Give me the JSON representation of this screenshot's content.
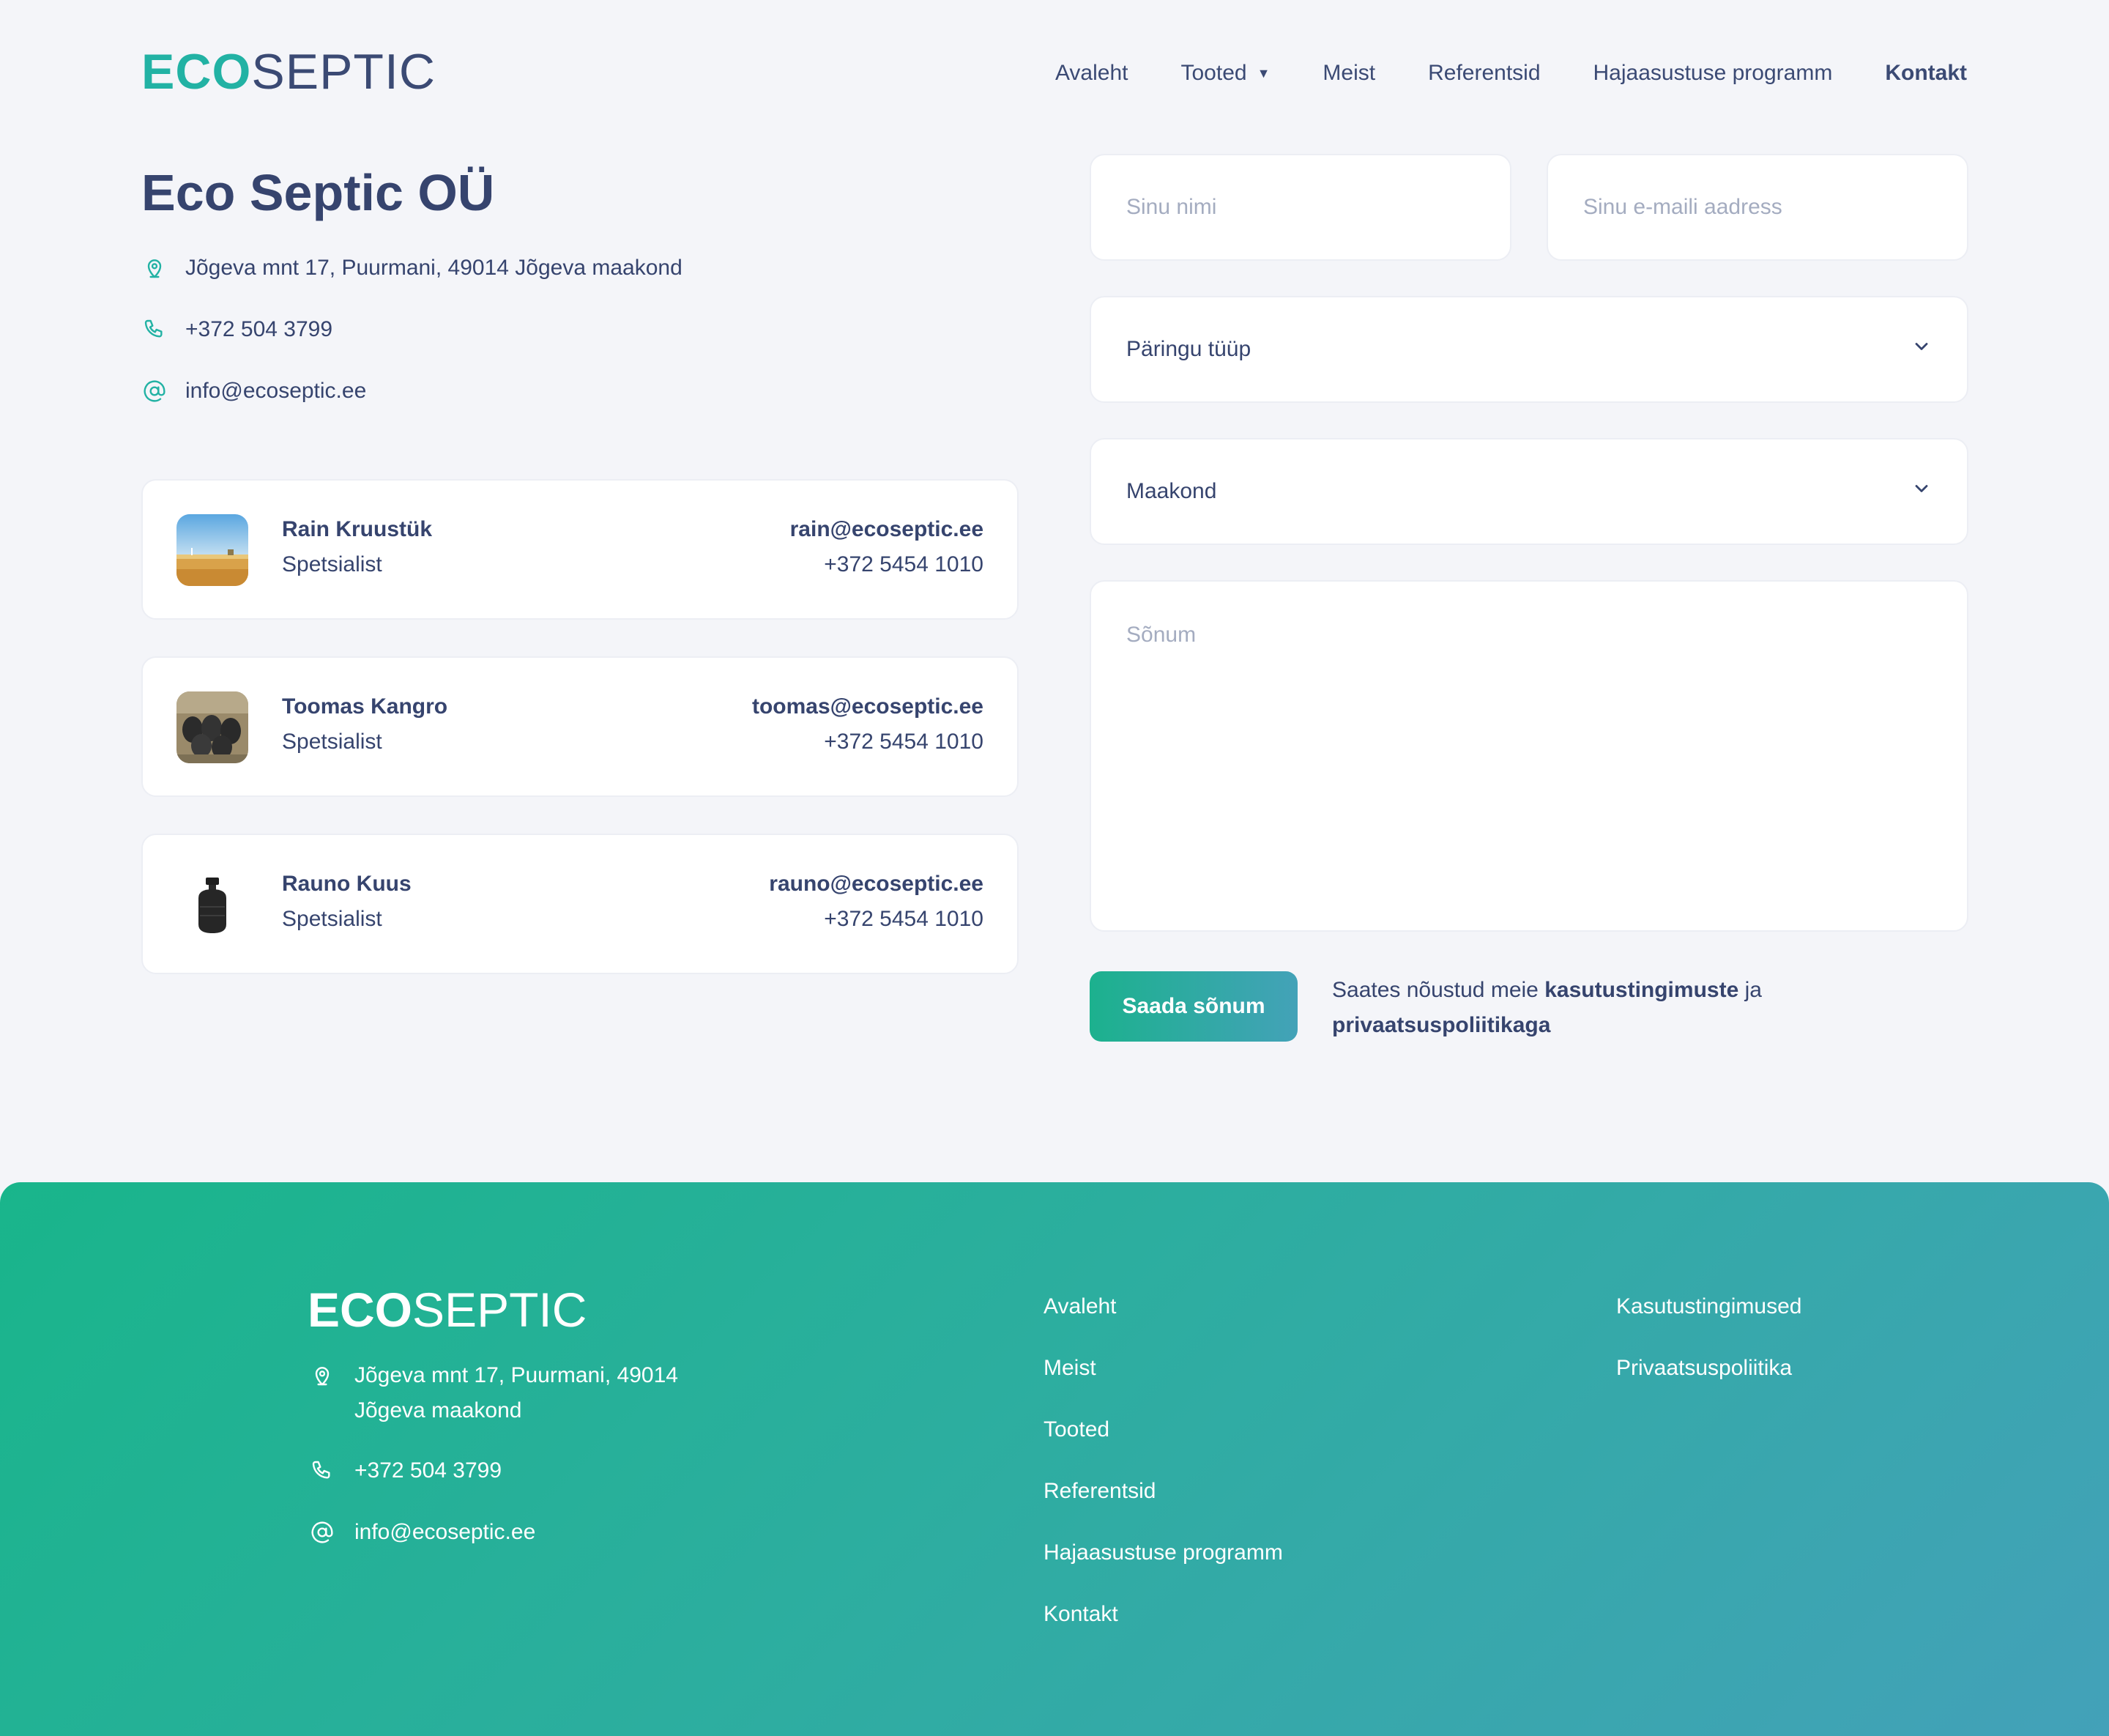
{
  "header": {
    "logo_eco": "ECO",
    "logo_septic": "SEPTIC",
    "nav": [
      {
        "label": "Avaleht"
      },
      {
        "label": "Tooted"
      },
      {
        "label": "Meist"
      },
      {
        "label": "Referentsid"
      },
      {
        "label": "Hajaasustuse programm"
      },
      {
        "label": "Kontakt"
      }
    ],
    "active_nav": "Kontakt"
  },
  "company": {
    "title": "Eco Septic OÜ",
    "address": "Jõgeva mnt 17, Puurmani, 49014 Jõgeva maakond",
    "phone": "+372 504 3799",
    "email": "info@ecoseptic.ee"
  },
  "contacts": [
    {
      "name": "Rain Kruustük",
      "role": "Spetsialist",
      "email": "rain@ecoseptic.ee",
      "phone": "+372 5454 1010",
      "photo": "field-landscape"
    },
    {
      "name": "Toomas Kangro",
      "role": "Spetsialist",
      "email": "toomas@ecoseptic.ee",
      "phone": "+372 5454 1010",
      "photo": "septic-tanks-pile"
    },
    {
      "name": "Rauno Kuus",
      "role": "Spetsialist",
      "email": "rauno@ecoseptic.ee",
      "phone": "+372 5454 1010",
      "photo": "black-septic-tank"
    }
  ],
  "form": {
    "name_placeholder": "Sinu nimi",
    "email_placeholder": "Sinu e-maili aadress",
    "query_type": "Päringu tüüp",
    "county": "Maakond",
    "message_placeholder": "Sõnum",
    "submit_label": "Saada sõnum",
    "consent_prefix": "Saates nõustud meie",
    "consent_terms": "kasutustingimuste",
    "consent_and": "ja",
    "consent_privacy": "privaatsuspoliitikaga"
  },
  "footer": {
    "logo_eco": "ECO",
    "logo_septic": "SEPTIC",
    "address_line1": "Jõgeva mnt 17, Puurmani, 49014",
    "address_line2": "Jõgeva maakond",
    "phone": "+372 504 3799",
    "email": "info@ecoseptic.ee",
    "nav": [
      "Avaleht",
      "Meist",
      "Tooted",
      "Referentsid",
      "Hajaasustuse programm",
      "Kontakt"
    ],
    "legal": [
      "Kasutustingimused",
      "Privaatsuspoliitika"
    ]
  },
  "colors": {
    "accent": "#22b2a4",
    "text": "#36446e",
    "background": "#f4f5f9",
    "footer_gradient_start": "#19b58b",
    "footer_gradient_end": "#43a1b9"
  }
}
